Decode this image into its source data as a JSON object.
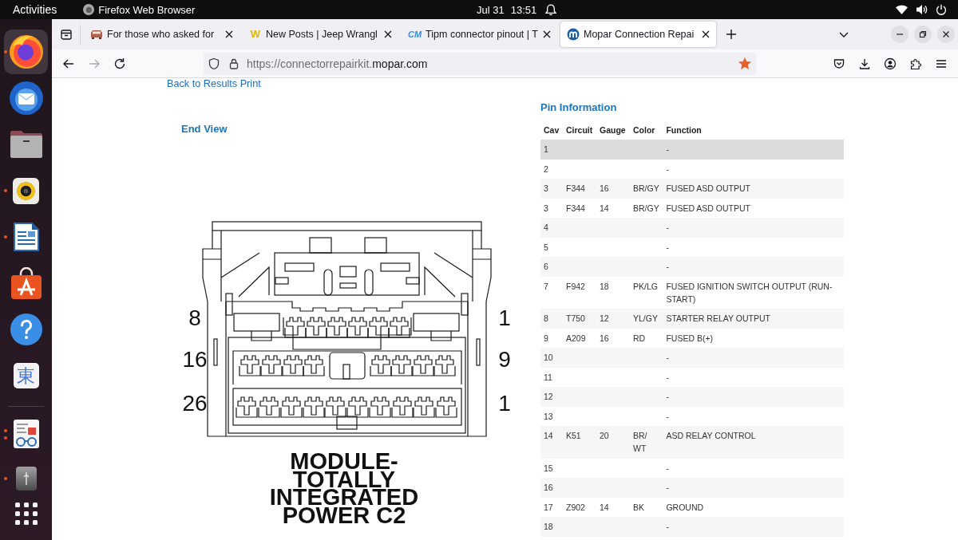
{
  "top_bar": {
    "activities": "Activities",
    "app_name": "Firefox Web Browser",
    "date": "Jul 31",
    "time": "13:51"
  },
  "dock": {
    "pinned": [
      {
        "kind": "firefox",
        "focused": true,
        "running": true,
        "multiple_windows": false
      },
      {
        "kind": "mail",
        "focused": false,
        "running": false,
        "multiple_windows": false
      },
      {
        "kind": "files",
        "focused": false,
        "running": false,
        "multiple_windows": false
      },
      {
        "kind": "music",
        "focused": false,
        "running": true,
        "multiple_windows": false
      },
      {
        "kind": "writer",
        "focused": false,
        "running": true,
        "multiple_windows": false
      },
      {
        "kind": "store",
        "focused": false,
        "running": false,
        "multiple_windows": false
      },
      {
        "kind": "help",
        "focused": false,
        "running": false,
        "multiple_windows": false
      },
      {
        "kind": "input",
        "glyph": "東",
        "focused": false,
        "running": false,
        "multiple_windows": false
      }
    ],
    "unpinned": [
      {
        "kind": "viewer",
        "focused": false,
        "running": true,
        "multiple_windows": true
      },
      {
        "kind": "generic",
        "focused": false,
        "running": true,
        "multiple_windows": false
      }
    ]
  },
  "browser": {
    "tabs": [
      {
        "title": "For those who asked for",
        "selected": false,
        "favicon": {
          "kind": "car"
        }
      },
      {
        "title": "New Posts | Jeep Wrangl",
        "selected": false,
        "favicon": {
          "kind": "text",
          "text": "W",
          "color": "#e2b40c",
          "italic": false
        }
      },
      {
        "title": "Tipm connector pinout | T",
        "selected": false,
        "favicon": {
          "kind": "text",
          "text": "CM",
          "color": "#3a8dd6",
          "italic": true
        }
      },
      {
        "title": "Mopar Connection Repai",
        "selected": true,
        "favicon": {
          "kind": "logo"
        }
      }
    ],
    "forward_disabled": true,
    "url_prefix": "https://connectorrepairkit.",
    "url_domain": "mopar.com",
    "bookmarked": true
  },
  "page": {
    "links": [
      "Back to Results",
      "Print"
    ],
    "end_view": {
      "heading": "End View",
      "left_labels": [
        "8",
        "16",
        "26"
      ],
      "right_labels": [
        "1",
        "9",
        "1"
      ],
      "caption": "MODULE- TOTALLY INTEGRATED POWER C2"
    },
    "pin_info": {
      "heading": "Pin Information",
      "columns": [
        "Cav",
        "Circuit",
        "Gauge",
        "Color",
        "Function"
      ],
      "rows": [
        {
          "cav": "1",
          "function": "-",
          "hovered": true
        },
        {
          "cav": "2",
          "function": "-",
          "hovered": false
        },
        {
          "cav": "3",
          "circuit": "F344",
          "gauge": "16",
          "wire_color": "BR/GY",
          "function": "FUSED ASD OUTPUT",
          "hovered": false
        },
        {
          "cav": "3",
          "circuit": "F344",
          "gauge": "14",
          "wire_color": "BR/GY",
          "function": "FUSED ASD OUTPUT",
          "hovered": false
        },
        {
          "cav": "4",
          "function": "-",
          "hovered": false
        },
        {
          "cav": "5",
          "function": "-",
          "hovered": false
        },
        {
          "cav": "6",
          "function": "-",
          "hovered": false
        },
        {
          "cav": "7",
          "circuit": "F942",
          "gauge": "18",
          "wire_color": "PK/LG",
          "function": "FUSED IGNITION SWITCH OUTPUT (RUN-START)",
          "hovered": false
        },
        {
          "cav": "8",
          "circuit": "T750",
          "gauge": "12",
          "wire_color": "YL/GY",
          "function": "STARTER RELAY OUTPUT",
          "hovered": false
        },
        {
          "cav": "9",
          "circuit": "A209",
          "gauge": "16",
          "wire_color": "RD",
          "function": "FUSED B(+)",
          "hovered": false
        },
        {
          "cav": "10",
          "function": "-",
          "hovered": false
        },
        {
          "cav": "11",
          "function": "-",
          "hovered": false
        },
        {
          "cav": "12",
          "function": "-",
          "hovered": false
        },
        {
          "cav": "13",
          "function": "-",
          "hovered": false
        },
        {
          "cav": "14",
          "circuit": "K51",
          "gauge": "20",
          "wire_color": "BR/WT",
          "function": "ASD RELAY CONTROL",
          "hovered": false
        },
        {
          "cav": "15",
          "function": "-",
          "hovered": false
        },
        {
          "cav": "16",
          "function": "-",
          "hovered": false
        },
        {
          "cav": "17",
          "circuit": "Z902",
          "gauge": "14",
          "wire_color": "BK",
          "function": "GROUND",
          "hovered": false
        },
        {
          "cav": "18",
          "function": "-",
          "hovered": false
        }
      ]
    }
  }
}
